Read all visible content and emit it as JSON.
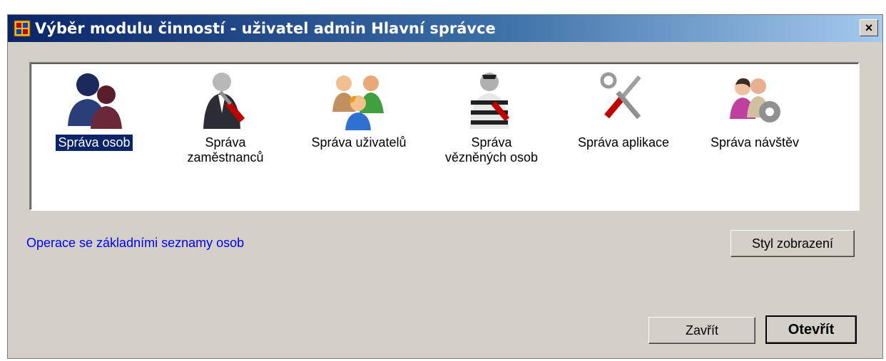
{
  "window": {
    "title": "Výběr modulu činností - uživatel admin Hlavní správce",
    "close_glyph": "×"
  },
  "modules": [
    {
      "label": "Správa osob",
      "icon": "people-icon",
      "selected": true
    },
    {
      "label": "Správa\nzaměstnanců",
      "icon": "employee-tools-icon",
      "selected": false
    },
    {
      "label": "Správa uživatelů",
      "icon": "users-group-icon",
      "selected": false
    },
    {
      "label": "Správa\nvězněných osob",
      "icon": "prisoner-icon",
      "selected": false
    },
    {
      "label": "Správa aplikace",
      "icon": "tools-icon",
      "selected": false
    },
    {
      "label": "Správa návštěv",
      "icon": "visitors-gear-icon",
      "selected": false
    }
  ],
  "description": "Operace se základními seznamy osob",
  "buttons": {
    "style": "Styl zobrazení",
    "close": "Zavřít",
    "open": "Otevřít"
  },
  "colors": {
    "selection": "#0a246a",
    "link_text": "#0000ff",
    "dialog_bg": "#d4d0c8"
  }
}
